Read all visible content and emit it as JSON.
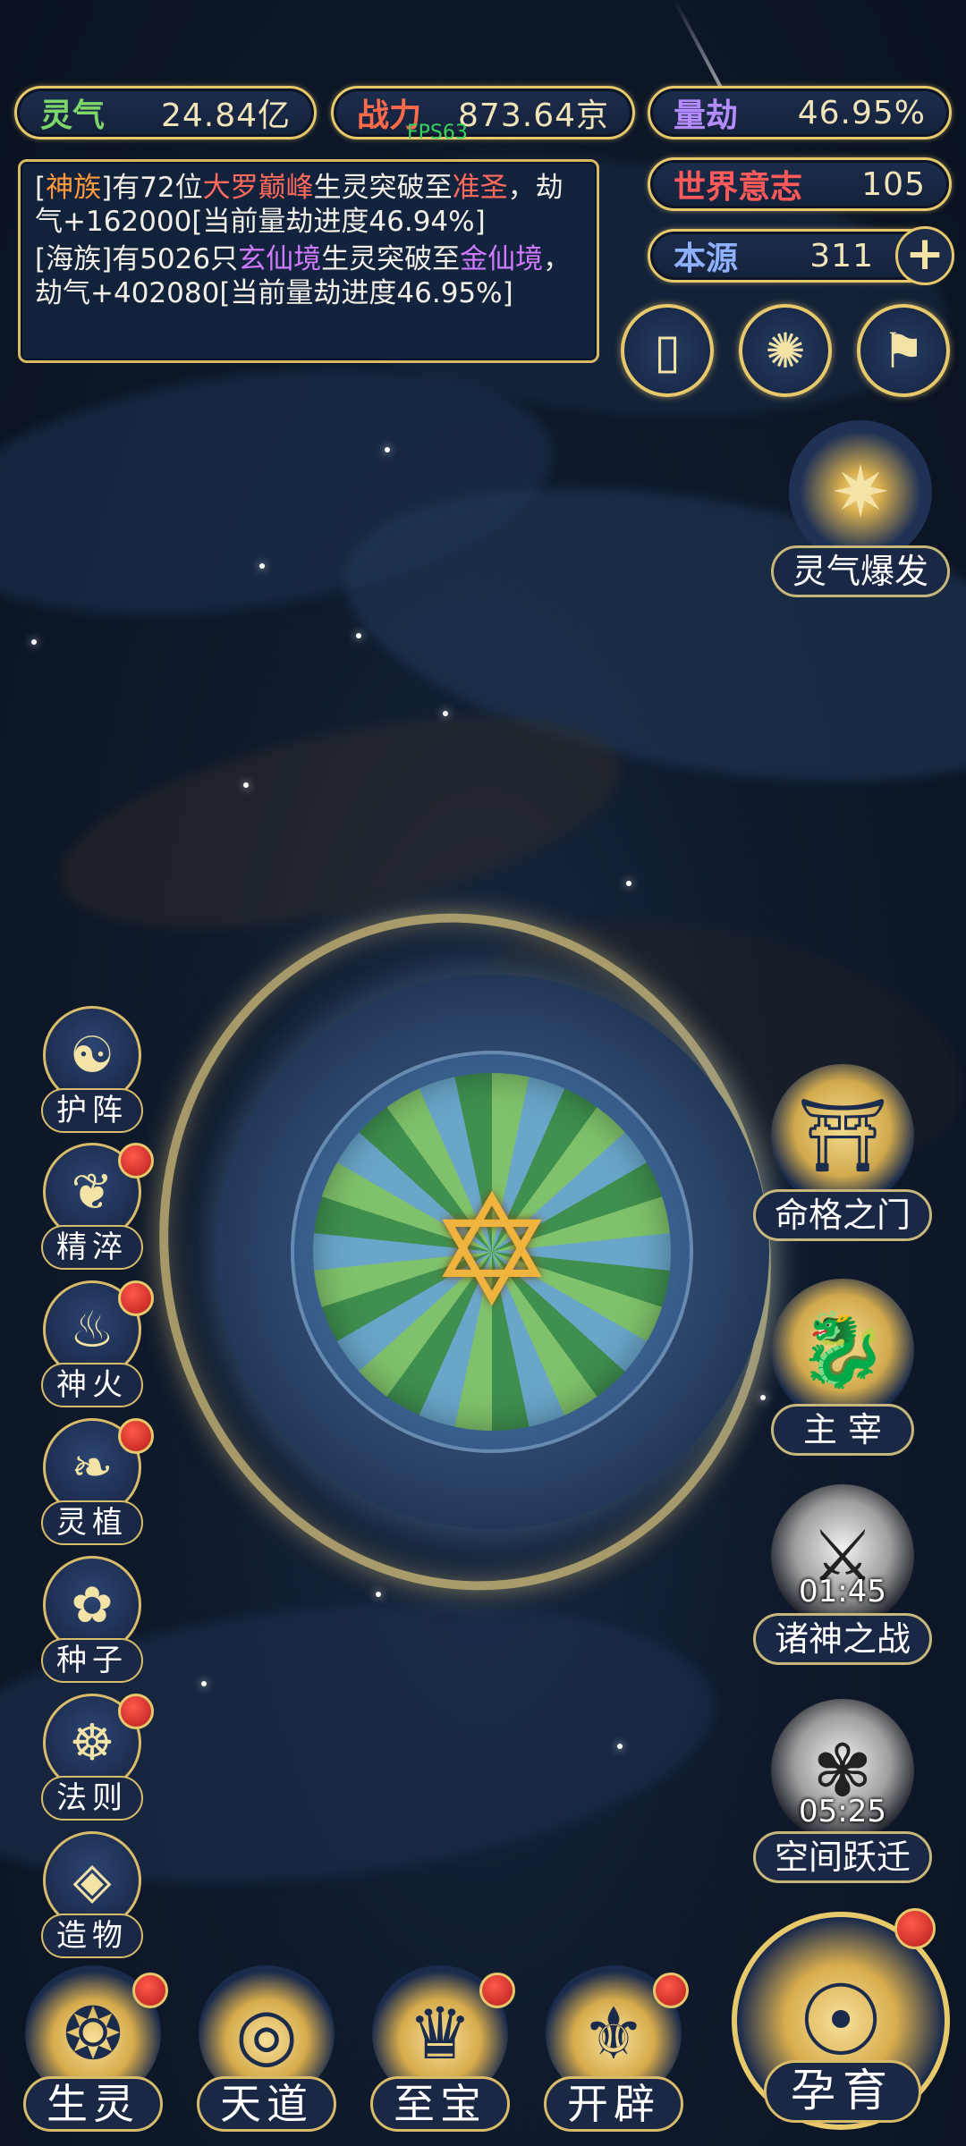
{
  "stats": {
    "lingqi": {
      "label": "灵气",
      "value": "24.84亿"
    },
    "zhanli": {
      "label": "战力",
      "value": "873.64京"
    },
    "liangjie": {
      "label": "量劫",
      "value": "46.95%"
    },
    "shijie": {
      "label": "世界意志",
      "value": "105"
    },
    "benyuan": {
      "label": "本源",
      "value": "311"
    },
    "fps": "FPS63"
  },
  "log": {
    "msg1": {
      "a": "[",
      "race": "神族",
      "b": "]有72位",
      "rank": "大罗巅峰",
      "c": "生灵突破至",
      "target": "准圣",
      "d": "，劫气+162000[当前量劫进度46.94%]"
    },
    "msg2": {
      "a": "[海族]有5026只",
      "rank": "玄仙境",
      "c": "生灵突破至",
      "target": "金仙境",
      "d": "，劫气+402080[当前量劫进度46.95%]"
    }
  },
  "burst_label": "灵气爆发",
  "left_menu": [
    {
      "label": "护阵",
      "icon": "yin-yang-icon",
      "badge": false
    },
    {
      "label": "精淬",
      "icon": "flame-crystal-icon",
      "badge": true
    },
    {
      "label": "神火",
      "icon": "fire-icon",
      "badge": true
    },
    {
      "label": "灵植",
      "icon": "plant-icon",
      "badge": true
    },
    {
      "label": "种子",
      "icon": "flower-icon",
      "badge": false
    },
    {
      "label": "法则",
      "icon": "rune-icon",
      "badge": true
    },
    {
      "label": "造物",
      "icon": "diamond-icon",
      "badge": false
    }
  ],
  "right_menu": {
    "gate": {
      "label": "命格之门",
      "icon": "gate-icon"
    },
    "ruler": {
      "label": "主 宰",
      "icon": "dragon-icon"
    },
    "war": {
      "label": "诸神之战",
      "timer": "01:45",
      "icon": "sword-icon"
    },
    "leap": {
      "label": "空间跃迁",
      "timer": "05:25",
      "icon": "portal-icon"
    }
  },
  "bottom_nav": [
    {
      "label": "生灵",
      "icon": "phoenix-icon",
      "badge": true
    },
    {
      "label": "天道",
      "icon": "wave-icon",
      "badge": false
    },
    {
      "label": "至宝",
      "icon": "treasure-icon",
      "badge": true
    },
    {
      "label": "开辟",
      "icon": "axe-icon",
      "badge": true
    }
  ],
  "main_action": {
    "label": "孕育",
    "icon": "embryo-icon",
    "badge": true
  },
  "colors": {
    "gold": "#e7c86a",
    "badge_red": "#d8322a",
    "bg": "#0f1a2c"
  }
}
